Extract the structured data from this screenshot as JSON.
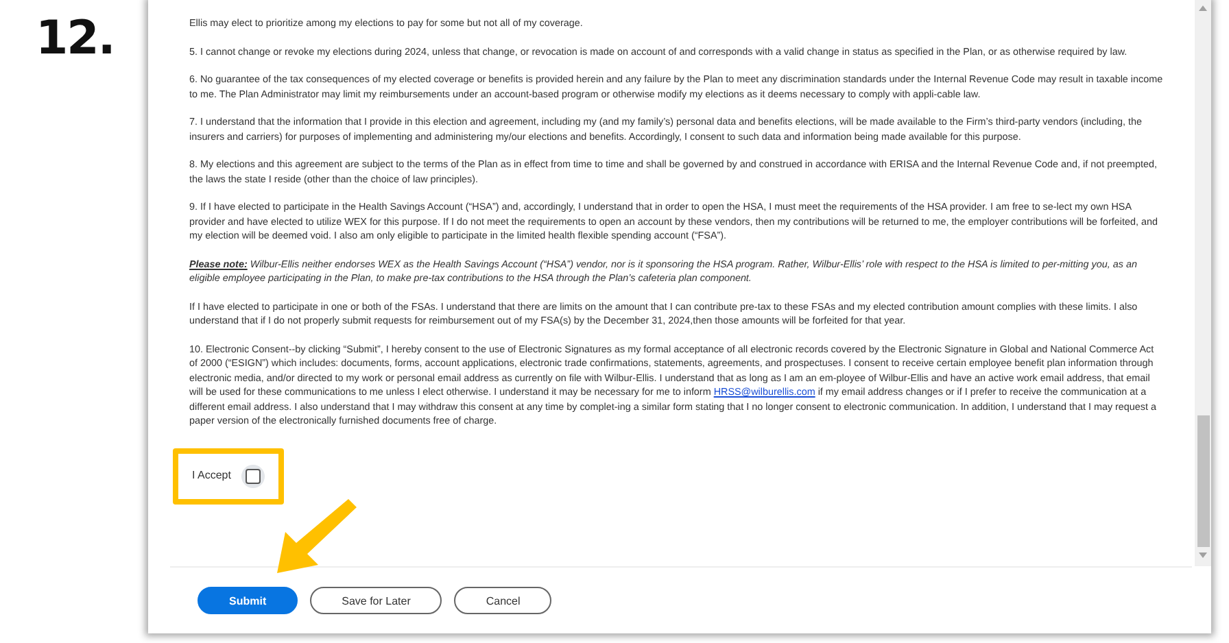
{
  "step": "12.",
  "paragraphs": [
    {
      "kind": "plain",
      "text": "Ellis may elect to prioritize among my elections to pay for some but not all of my coverage."
    },
    {
      "kind": "plain",
      "text": "5. I cannot change or revoke my elections during 2024, unless that change, or revocation is made on account of and corresponds with a valid change in status as specified in the Plan, or as otherwise required by law."
    },
    {
      "kind": "plain",
      "text": "6. No guarantee of the tax consequences of my elected coverage or benefits is provided herein and any failure by the Plan to meet any discrimination standards under the Internal Revenue Code may result in taxable income to me.  The Plan Administrator may limit my reimbursements under an account-based program or otherwise modify my elections as it deems necessary to comply with appli-cable law."
    },
    {
      "kind": "plain",
      "text": "7. I understand that the information that I provide in this election and agreement, including my (and my family’s) personal data and benefits elections, will be made available to the Firm’s third-party vendors (including, the insurers and carriers) for purposes of implementing and administering my/our elections and benefits.  Accordingly, I consent to such data and information being made available for this purpose."
    },
    {
      "kind": "plain",
      "text": "8. My elections and this agreement are subject to the terms of the Plan as in effect from time to time and shall be governed by and construed in accordance with ERISA and the Internal Revenue Code and, if not preempted, the laws the state I reside (other than the choice of law principles)."
    },
    {
      "kind": "plain",
      "text": "9. If I have elected to participate in the Health Savings Account (“HSA”) and, accordingly, I understand that in order to open the HSA, I must meet the requirements of the HSA provider.  I am free to se-lect my own HSA provider and have elected to utilize WEX for this purpose.  If I do not meet the requirements to open an account by these vendors, then my contributions will be returned to me, the employer contributions will be forfeited, and my election will be deemed void. I also am only eligible to participate in the limited health flexible spending account (“FSA”)."
    },
    {
      "kind": "note",
      "lead": "Please note:",
      "text": "Wilbur-Ellis neither endorses WEX as the Health Savings Account (“HSA”) vendor, nor is it sponsoring the HSA program.  Rather, Wilbur-Ellis’ role with respect to the HSA is limited to per-mitting you, as an eligible employee participating in the Plan, to make pre-tax contributions to the HSA through the Plan’s cafeteria plan component."
    },
    {
      "kind": "plain",
      "text": "If I have elected to participate in one or both of the FSAs.  I understand that there are limits on the amount that I can contribute pre-tax to these FSAs and my elected contribution amount complies with these limits. I also understand that if I do not properly submit requests for reimbursement out of my FSA(s) by the December 31, 2024,then those amounts will be forfeited for that year."
    },
    {
      "kind": "link",
      "text": "10. Electronic Consent--by clicking “Submit”, I hereby consent to the use of Electronic Signatures as my formal acceptance of all electronic records covered by the Electronic Signature in Global and National Commerce Act of 2000 (“ESIGN”) which includes: documents, forms, account applications, electronic trade confirmations, statements, agreements, and prospectuses.  I consent to receive certain employee benefit plan information through electronic media, and/or directed to my work or personal email address as currently on file with Wilbur-Ellis.  I understand that as long as I am an em-ployee of Wilbur-Ellis and have an active work email address, that email will be used for these communications to me unless I elect otherwise.  I understand it may be necessary for me to inform",
      "link": "HRSS@wilburellis.com",
      "after": "if my email address changes or if I prefer to receive the communication at a different email address.  I also understand that I may withdraw this consent at any time by complet-ing a similar form stating that I no longer consent to electronic communication.  In addition, I understand that I may request a paper version of the electronically furnished documents free of charge."
    }
  ],
  "accept": {
    "label": "I Accept",
    "checked": false
  },
  "buttons": [
    {
      "label": "Submit",
      "kind": "primary"
    },
    {
      "label": "Save for Later",
      "kind": "secondary"
    },
    {
      "label": "Cancel",
      "kind": "secondary"
    }
  ]
}
